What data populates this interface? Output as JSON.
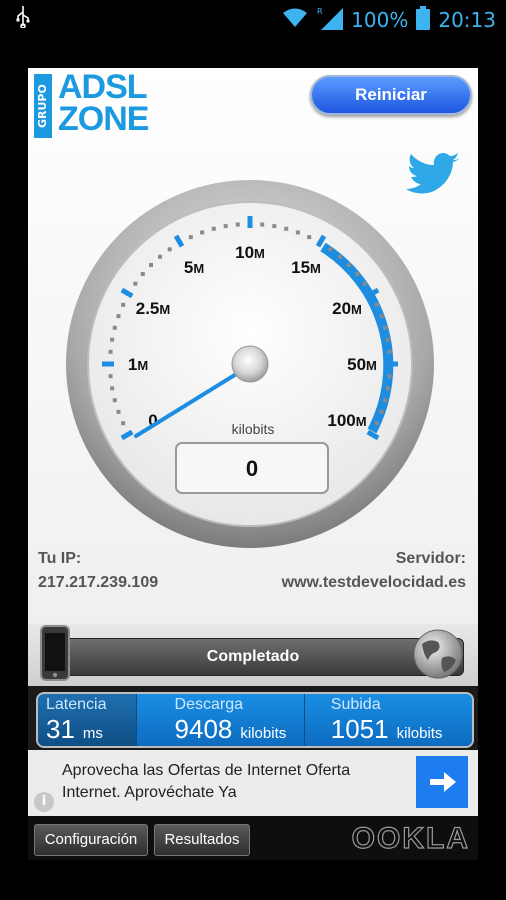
{
  "status_bar": {
    "battery": "100%",
    "time": "20:13"
  },
  "header": {
    "logo_grupo": "GRUPO",
    "logo_line1": "ADSL",
    "logo_line2": "ZONE",
    "restart_label": "Reiniciar"
  },
  "gauge": {
    "ticks": [
      {
        "num": "0",
        "unit": ""
      },
      {
        "num": "1",
        "unit": "M"
      },
      {
        "num": "2.5",
        "unit": "M"
      },
      {
        "num": "5",
        "unit": "M"
      },
      {
        "num": "10",
        "unit": "M"
      },
      {
        "num": "15",
        "unit": "M"
      },
      {
        "num": "20",
        "unit": "M"
      },
      {
        "num": "50",
        "unit": "M"
      },
      {
        "num": "100",
        "unit": "M"
      }
    ],
    "unit_label": "kilobits",
    "readout": "0",
    "accent": "#1c8de0"
  },
  "connection": {
    "ip_label": "Tu IP:",
    "ip_value": "217.217.239.109",
    "server_label": "Servidor:",
    "server_value": "www.testdevelocidad.es"
  },
  "progress": {
    "status": "Completado"
  },
  "results": {
    "latency": {
      "label": "Latencia",
      "value": "31",
      "unit": "ms"
    },
    "download": {
      "label": "Descarga",
      "value": "9408",
      "unit": "kilobits"
    },
    "upload": {
      "label": "Subida",
      "value": "1051",
      "unit": "kilobits"
    }
  },
  "ad": {
    "text": "Aprovecha las Ofertas de Internet Oferta Internet. Aprovéchate Ya",
    "info_icon": "i"
  },
  "footer": {
    "config_label": "Configuración",
    "results_label": "Resultados",
    "brand": "OOKLA"
  }
}
